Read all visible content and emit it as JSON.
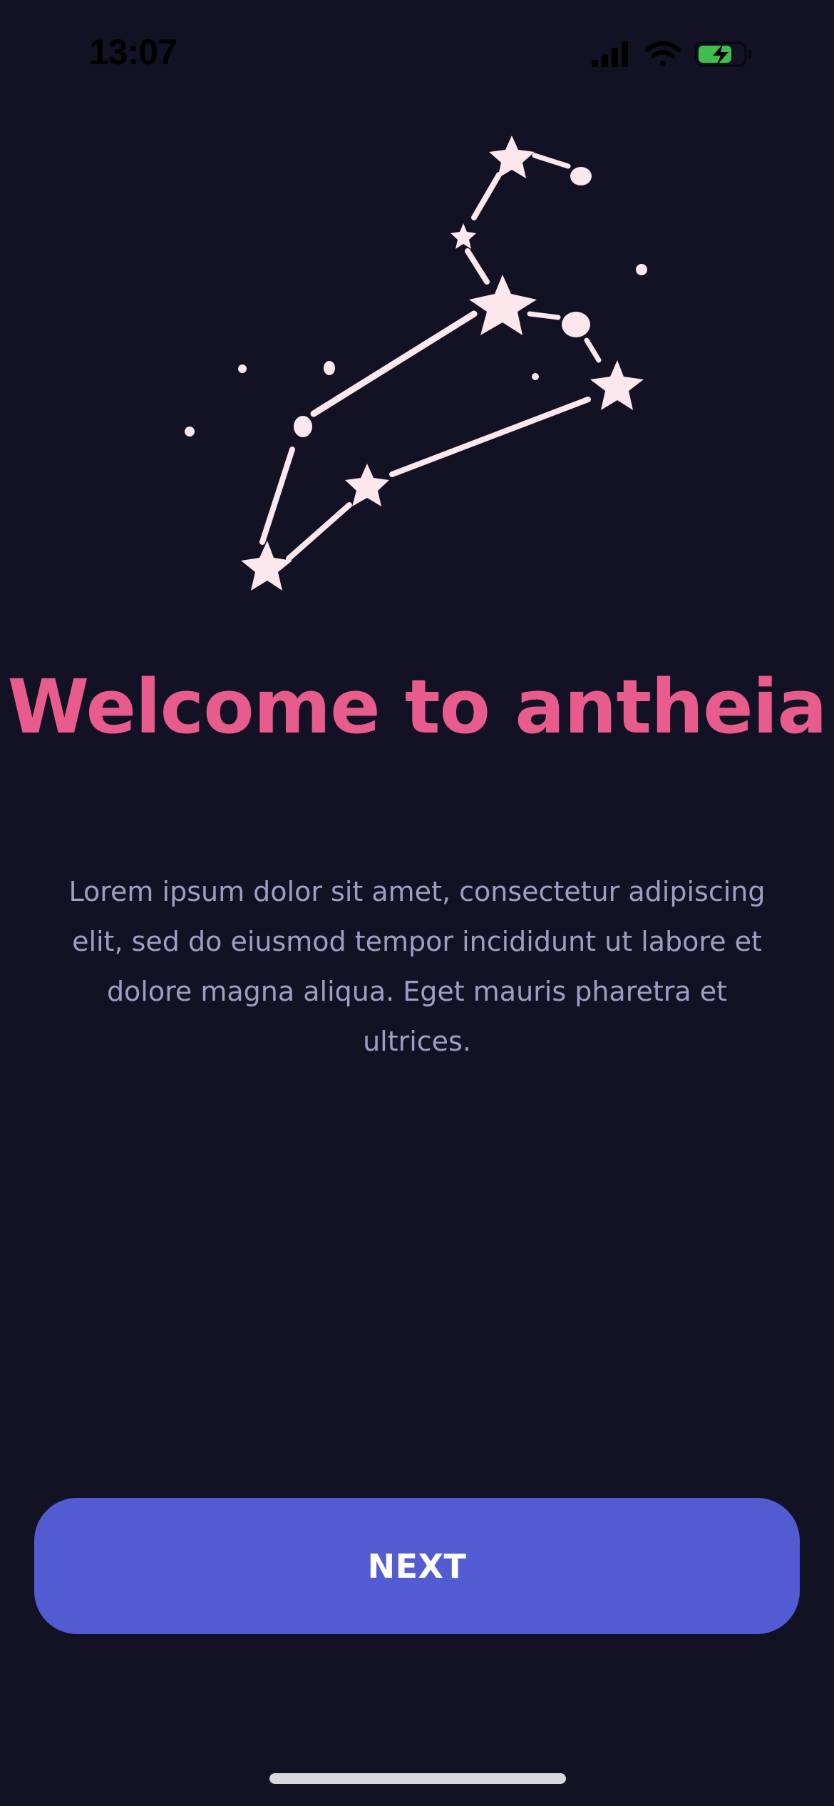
{
  "status_bar": {
    "time": "13:07",
    "icons": [
      "cellular-signal-icon",
      "wifi-icon",
      "battery-charging-icon"
    ]
  },
  "illustration": {
    "icon": "constellation-icon"
  },
  "onboarding": {
    "title": "Welcome to antheia",
    "description": "Lorem ipsum dolor sit amet, consectetur adipiscing elit, sed do eiusmod tempor incididunt ut labore et dolore magna aliqua. Eget mauris pharetra et ultrices."
  },
  "actions": {
    "next_label": "NEXT"
  },
  "colors": {
    "background": "#131224",
    "accent_title": "#E85C8D",
    "button": "#525BD2",
    "body_text": "#A09DC4",
    "stars": "#FBE7EC",
    "battery": "#3FBE4E"
  }
}
